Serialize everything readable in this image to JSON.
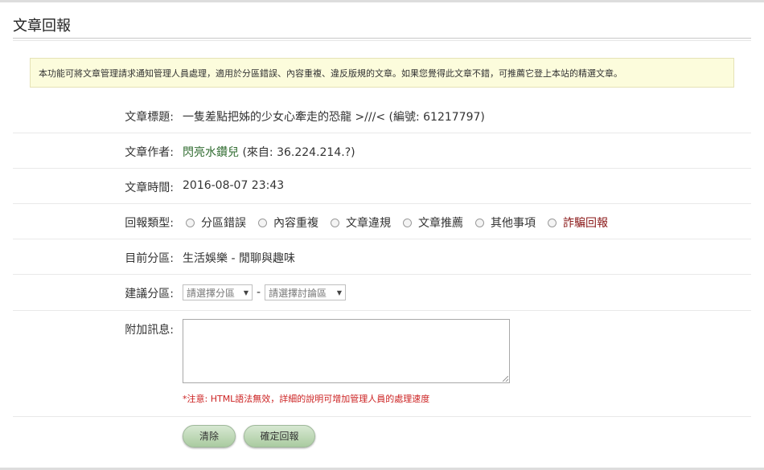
{
  "page": {
    "title": "文章回報",
    "notice": "本功能可將文章管理請求通知管理人員處理，適用於分區錯誤、內容重複、違反版規的文章。如果您覺得此文章不錯，可推薦它登上本站的精選文章。"
  },
  "form": {
    "article_title": {
      "label": "文章標題:",
      "value": "一隻差點把姊的少女心牽走的恐龍 >///< (編號: 61217797)"
    },
    "article_author": {
      "label": "文章作者:",
      "name": "閃亮水鑽兒",
      "source": "(來自: 36.224.214.?)"
    },
    "article_time": {
      "label": "文章時間:",
      "value": "2016-08-07 23:43"
    },
    "report_type": {
      "label": "回報類型:",
      "options": [
        "分區錯誤",
        "內容重複",
        "文章違規",
        "文章推薦",
        "其他事項",
        "詐騙回報"
      ]
    },
    "current_section": {
      "label": "目前分區:",
      "value": "生活娛樂 - 閒聊與趣味"
    },
    "suggested_section": {
      "label": "建議分區:",
      "section_placeholder": "請選擇分區",
      "board_placeholder": "請選擇討論區",
      "separator": "-"
    },
    "message": {
      "label": "附加訊息:",
      "note": "*注意: HTML語法無效，詳細的說明可增加管理人員的處理速度"
    }
  },
  "buttons": {
    "clear": "清除",
    "submit": "確定回報"
  },
  "colors": {
    "author_link": "#2f6b2f",
    "fraud_option": "#8b1a1a",
    "warning_text": "#cc2222",
    "notice_bg": "#fcfcdc",
    "button_green": "#aacba0"
  }
}
